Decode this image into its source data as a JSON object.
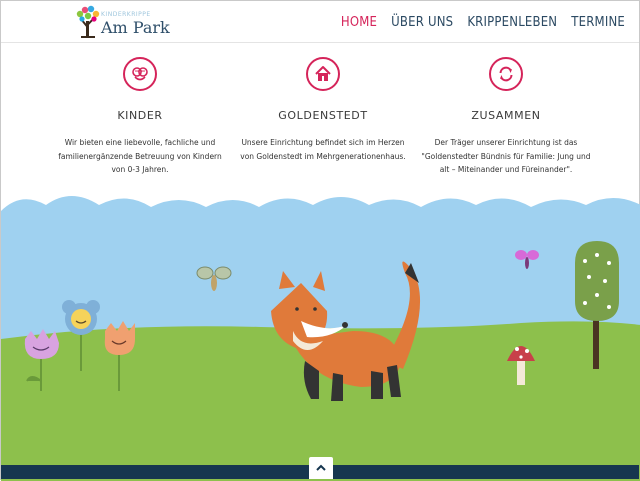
{
  "header": {
    "logo": {
      "tagline": "KINDERKRIPPE",
      "name": "Am Park"
    },
    "nav": [
      {
        "label": "HOME",
        "active": true
      },
      {
        "label": "ÜBER UNS",
        "active": false
      },
      {
        "label": "KRIPPENLEBEN",
        "active": false
      },
      {
        "label": "TERMINE",
        "active": false
      }
    ]
  },
  "features": [
    {
      "icon": "smiley-faces-icon",
      "title": "KINDER",
      "text": "Wir bieten eine liebevolle, fachliche und familienergänzende Betreuung von Kindern von 0-3 Jahren."
    },
    {
      "icon": "home-icon",
      "title": "GOLDENSTEDT",
      "text": "Unsere Einrichtung befindet sich im Herzen von Goldenstedt im Mehrgenerationenhaus."
    },
    {
      "icon": "refresh-icon",
      "title": "ZUSAMMEN",
      "text": "Der Träger unserer Einrichtung ist das \"Goldenstedter Bündnis für Familie: Jung und alt – Miteinander und Füreinander\"."
    }
  ],
  "colors": {
    "accent": "#d5245a",
    "nav_text": "#2c4a63",
    "sky": "#9fd1f0",
    "grass": "#8dc04c",
    "footer": "#16364f"
  },
  "footer": {
    "back_to_top_icon": "chevron-up-icon"
  }
}
